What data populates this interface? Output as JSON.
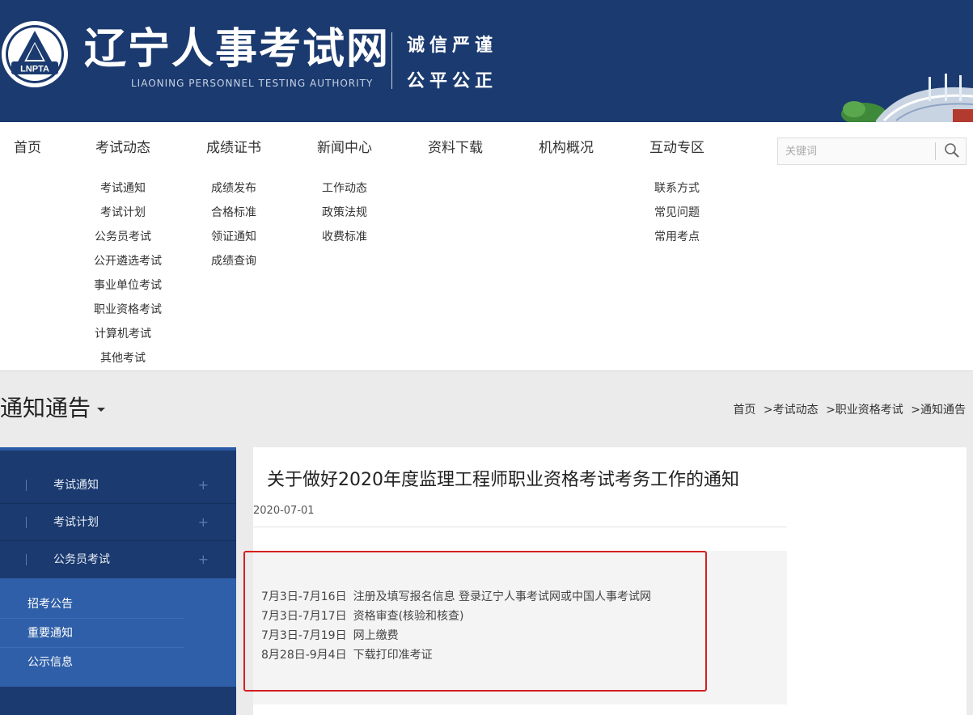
{
  "header": {
    "logo_text": "LNPTA",
    "site_title": "辽宁人事考试网",
    "site_subtitle": "LIAONING PERSONNEL TESTING AUTHORITY",
    "slogan_line1": "诚信严谨",
    "slogan_line2": "公平公正",
    "colors": {
      "header_bg": "#1b3a6f",
      "accent": "#2f5fa8",
      "highlight": "#d42020"
    }
  },
  "nav": {
    "items": [
      {
        "label": "首页",
        "subs": []
      },
      {
        "label": "考试动态",
        "subs": [
          "考试通知",
          "考试计划",
          "公务员考试",
          "公开遴选考试",
          "事业单位考试",
          "职业资格考试",
          "计算机考试",
          "其他考试"
        ]
      },
      {
        "label": "成绩证书",
        "subs": [
          "成绩发布",
          "合格标准",
          "领证通知",
          "成绩查询"
        ]
      },
      {
        "label": "新闻中心",
        "subs": [
          "工作动态",
          "政策法规",
          "收费标准"
        ]
      },
      {
        "label": "资料下载",
        "subs": []
      },
      {
        "label": "机构概况",
        "subs": []
      },
      {
        "label": "互动专区",
        "subs": [
          "联系方式",
          "常见问题",
          "常用考点"
        ]
      }
    ],
    "search": {
      "placeholder": "关键词",
      "icon": "search-icon"
    }
  },
  "section": {
    "title": "通知通告",
    "breadcrumb": [
      "首页",
      ">考试动态",
      ">职业资格考试",
      ">通知通告"
    ]
  },
  "sidebar": {
    "items": [
      {
        "label": "考试通知",
        "expand": "+"
      },
      {
        "label": "考试计划",
        "expand": "+"
      },
      {
        "label": "公务员考试",
        "expand": "+"
      }
    ],
    "sub_items": [
      "招考公告",
      "重要通知",
      "公示信息"
    ]
  },
  "article": {
    "title": "关于做好2020年度监理工程师职业资格考试考务工作的通知",
    "date": "2020-07-01",
    "schedule": [
      {
        "date": "7月3日-7月16日",
        "desc": "注册及填写报名信息 登录辽宁人事考试网或中国人事考试网"
      },
      {
        "date": "7月3日-7月17日",
        "desc": "资格审查(核验和核查)"
      },
      {
        "date": "7月3日-7月19日",
        "desc": "网上缴费"
      },
      {
        "date": "8月28日-9月4日",
        "desc": "下载打印准考证"
      }
    ]
  }
}
